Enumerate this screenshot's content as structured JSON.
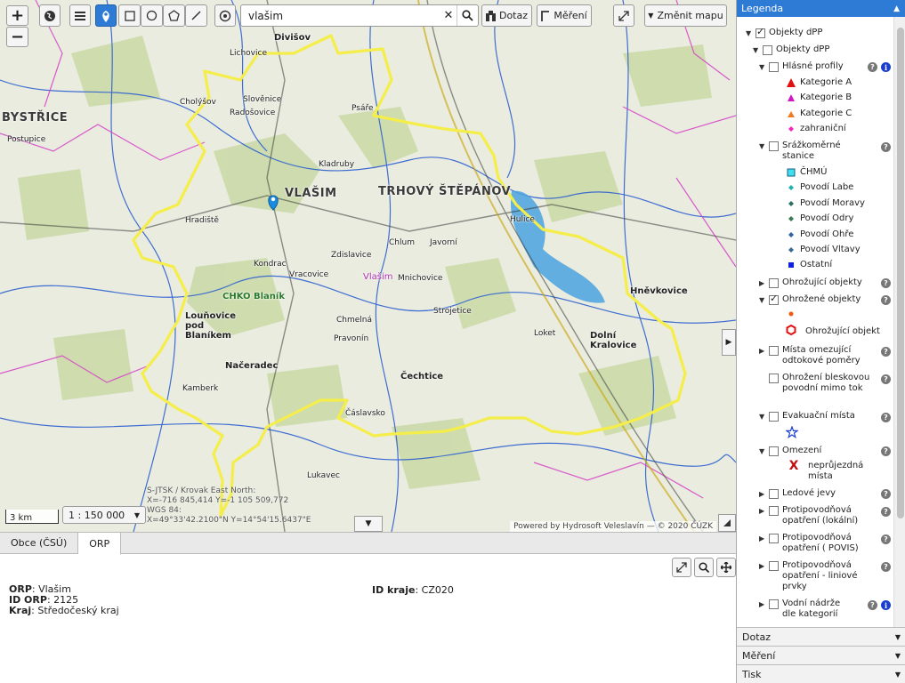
{
  "toolbar": {
    "zoom_in": "+",
    "zoom_out": "−",
    "search_value": "vlašim",
    "query_label": "Dotaz",
    "measure_label": "Měření",
    "change_map_label": "Změnit mapu"
  },
  "map": {
    "scale_label": "3 km",
    "scale_value": "1 : 150 000",
    "coords_line1": "S-JTSK / Krovak East North:",
    "coords_line2": "X=-716 845,414 Y=-1 105 509,772",
    "coords_line3": "WGS 84:",
    "coords_line4": "X=49°33'42.2100\"N Y=14°54'15.6437\"E",
    "attribution": "Powered by Hydrosoft Veleslavín — © 2020 ČÚZK",
    "places": {
      "divisov": "Divišov",
      "lichovice": "Lichovice",
      "radosovice": "Radošovice",
      "slovenice": "Slověnice",
      "cholysov": "Cholýšov",
      "vlasim": "VLAŠIM",
      "trhovy": "TRHOVÝ ŠTĚPÁNOV",
      "hradiste": "Hradiště",
      "kondrac": "Kondrac",
      "vracovice": "Vracovice",
      "zdislavice": "Zdislavice",
      "chlum": "Chlum",
      "javorni": "Javorní",
      "mnichovice": "Mnichovice",
      "louhovice": "Louňovice pod Blaníkem",
      "nacheradec": "Načeradec",
      "chmeina": "Chmelná",
      "strojetice": "Strojetice",
      "pravonin": "Pravonín",
      "kamberk": "Kamberk",
      "cechtice": "Čechtice",
      "caslavsko": "Čáslavsko",
      "lukavec": "Lukavec",
      "psare": "Psáře",
      "kladruby": "Kladruby",
      "hnevkovice": "Hněvkovice",
      "dolni_kralovice": "Dolní Kralovice",
      "loket": "Loket",
      "hulice": "Hulice",
      "bystrice": "BYSTŘICE",
      "postupice": "Postupice",
      "vlasim_pink": "Vlašim",
      "ckh_blanik": "CHKO Blaník"
    }
  },
  "bottom": {
    "tabs": [
      "Obce (ČSÚ)",
      "ORP"
    ],
    "orp_key": "ORP",
    "orp_val": "Vlašim",
    "id_orp_key": "ID ORP",
    "id_orp_val": "2125",
    "kraj_key": "Kraj",
    "kraj_val": "Středočeský kraj",
    "id_kraje_key": "ID kraje",
    "id_kraje_val": "CZ020"
  },
  "legend": {
    "title": "Legenda",
    "objekty_dpp_1": "Objekty dPP",
    "objekty_dpp_2": "Objekty dPP",
    "hlasne": "Hlásné profily",
    "kat_a": "Kategorie A",
    "kat_b": "Kategorie B",
    "kat_c": "Kategorie C",
    "zahranicni": "zahraniční",
    "srazkomerne": "Srážkoměrné stanice",
    "chmu": "ČHMÚ",
    "labe": "Povodí Labe",
    "morava": "Povodí Moravy",
    "odra": "Povodí Odry",
    "ohre": "Povodí Ohře",
    "vltava": "Povodí Vltavy",
    "ostatni": "Ostatní",
    "ohrozujici": "Ohrožující objekty",
    "ohrozene": "Ohrožené objekty",
    "ohrozujici_objekt": "Ohrožující objekt",
    "mista_omezujici": "Místa omezující odtokové poměry",
    "bleskova": "Ohrožení bleskovou povodní mimo tok",
    "evakuacni": "Evakuační místa",
    "omezeni": "Omezení",
    "nepruj": "neprůjezdná místa",
    "ledove": "Ledové jevy",
    "protipov_lok": "Protipovodňová opatření (lokální)",
    "protipov_povis": "Protipovodňová opatření ( POVIS)",
    "protipov_lin": "Protipovodňová opatření - liniové prvky",
    "vodni_nadrze": "Vodní nádrže dle kategorií"
  },
  "accordion": {
    "dotaz": "Dotaz",
    "mereni": "Měření",
    "tisk": "Tisk"
  }
}
